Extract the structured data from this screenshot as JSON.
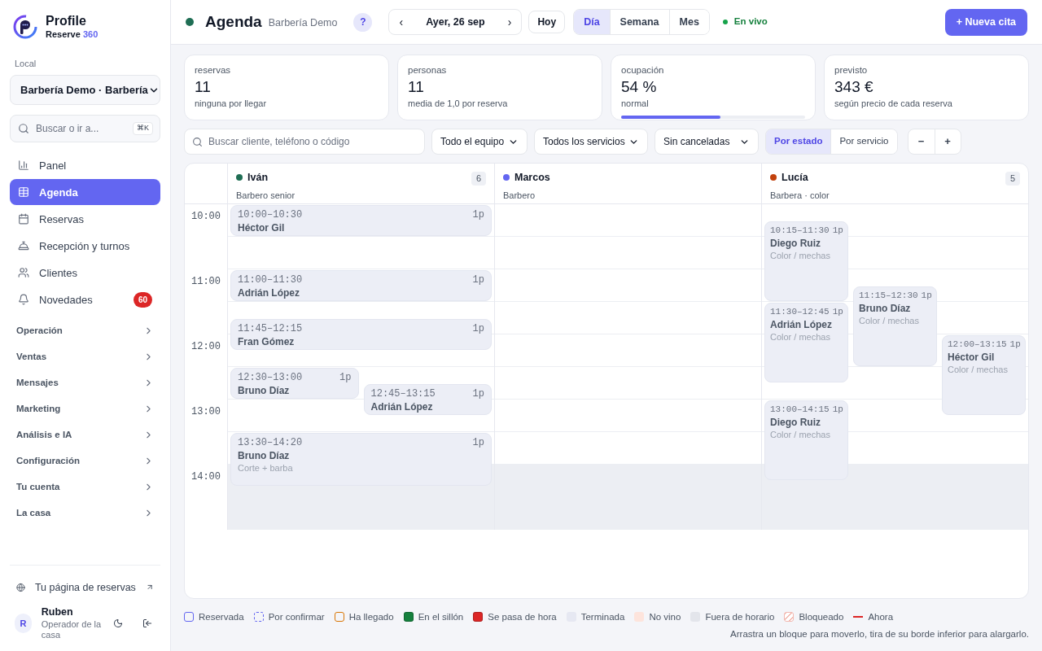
{
  "brand": {
    "name": "Profile",
    "sub": "Reserve",
    "sub_accent": "360"
  },
  "sidebar": {
    "local_label": "Local",
    "local_value": "Barbería Demo · Barbería",
    "search_placeholder": "Buscar o ir a...",
    "shortcut": "⌘K",
    "items": [
      {
        "kind": "panel",
        "label": "Panel",
        "selected": false
      },
      {
        "kind": "agenda",
        "label": "Agenda",
        "selected": true
      },
      {
        "kind": "reservas",
        "label": "Reservas",
        "selected": false
      },
      {
        "kind": "recepcion",
        "label": "Recepción y turnos",
        "selected": false
      },
      {
        "kind": "clientes",
        "label": "Clientes",
        "selected": false
      },
      {
        "kind": "novedades",
        "label": "Novedades",
        "selected": false,
        "badge": "60"
      }
    ],
    "sections": [
      {
        "label": "Operación",
        "expanded": false
      },
      {
        "label": "Ventas",
        "expanded": false
      },
      {
        "label": "Mensajes",
        "expanded": false
      },
      {
        "label": "Marketing",
        "expanded": false
      },
      {
        "label": "Análisis e IA",
        "expanded": false
      },
      {
        "label": "Configuración",
        "expanded": false
      },
      {
        "label": "Tu cuenta",
        "expanded": false
      },
      {
        "label": "La casa",
        "expanded": false
      }
    ],
    "public_link": "Tu página de reservas",
    "user": {
      "initial": "R",
      "name": "Ruben",
      "role": "Operador de la casa"
    }
  },
  "header": {
    "title": "Agenda",
    "subtitle": "Barbería Demo",
    "help": "?",
    "prev": "‹",
    "date": "Ayer, 26 sep",
    "next": "›",
    "today": "Hoy",
    "views": [
      {
        "label": "Día",
        "selected": true
      },
      {
        "label": "Semana",
        "selected": false
      },
      {
        "label": "Mes",
        "selected": false
      }
    ],
    "live": "En vivo",
    "new_button": "+ Nueva cita"
  },
  "stats": [
    {
      "label": "reservas",
      "value": "11",
      "note": "ninguna por llegar"
    },
    {
      "label": "personas",
      "value": "11",
      "note": "media de 1,0 por reserva"
    },
    {
      "label": "ocupación",
      "value": "54 %",
      "note": "normal",
      "level": 0.54
    },
    {
      "label": "previsto",
      "value": "343 €",
      "note": "según precio de cada reserva"
    }
  ],
  "filters": {
    "search_placeholder": "Buscar cliente, teléfono o código",
    "team": "Todo el equipo",
    "services": "Todos los servicios",
    "cancel": "Sin canceladas",
    "color_modes": [
      {
        "label": "Por estado",
        "selected": true
      },
      {
        "label": "Por servicio",
        "selected": false
      }
    ],
    "zoom_out": "−",
    "zoom_in": "+"
  },
  "calendar": {
    "hours": [
      {
        "label": "10:00",
        "open": true
      },
      {
        "label": "11:00",
        "open": true
      },
      {
        "label": "12:00",
        "open": true
      },
      {
        "label": "13:00",
        "open": true
      },
      {
        "label": "14:00",
        "open": false
      }
    ],
    "staff": [
      {
        "name": "Iván",
        "role": "Barbero senior",
        "color": "#1f6e54",
        "count": "6",
        "events": [
          {
            "kind": "finished",
            "time": "10:00–10:30",
            "people": "1p",
            "client": "Héctor Gil"
          },
          {
            "kind": "finished",
            "time": "11:00–11:30",
            "people": "1p",
            "client": "Adrián López"
          },
          {
            "kind": "finished",
            "time": "11:45–12:15",
            "people": "1p",
            "client": "Fran Gómez"
          },
          {
            "kind": "finished",
            "time": "12:30–13:00",
            "people": "1p",
            "client": "Bruno Díaz"
          },
          {
            "kind": "finished",
            "time": "12:45–13:15",
            "people": "1p",
            "client": "Adrián López"
          },
          {
            "kind": "finished",
            "time": "13:30–14:20",
            "people": "1p",
            "client": "Bruno Díaz",
            "service": "Corte + barba"
          }
        ]
      },
      {
        "name": "Marcos",
        "role": "Barbero",
        "color": "#6366f1"
      },
      {
        "name": "Lucía",
        "role": "Barbera · color",
        "color": "#c2410c",
        "count": "5",
        "events": [
          {
            "kind": "finished",
            "time": "10:15–11:30",
            "people": "1p",
            "client": "Diego Ruiz",
            "service": "Color / mechas"
          },
          {
            "kind": "finished",
            "time": "11:15–12:30",
            "people": "1p",
            "client": "Bruno Díaz",
            "service": "Color / mechas"
          },
          {
            "kind": "finished",
            "time": "11:30–12:45",
            "people": "1p",
            "client": "Adrián López",
            "service": "Color / mechas"
          },
          {
            "kind": "finished",
            "time": "12:00–13:15",
            "people": "1p",
            "client": "Héctor Gil",
            "service": "Color / mechas"
          },
          {
            "kind": "finished",
            "time": "13:00–14:15",
            "people": "1p",
            "client": "Diego Ruiz",
            "service": "Color / mechas"
          }
        ]
      }
    ]
  },
  "legend": [
    {
      "kind": "outline",
      "color": "#6366f1",
      "label": "Reservada"
    },
    {
      "kind": "dashed",
      "color": "#6366f1",
      "label": "Por confirmar"
    },
    {
      "kind": "outline",
      "color": "#d97706",
      "label": "Ha llegado"
    },
    {
      "kind": "filled",
      "color": "#15803d",
      "label": "En el sillón"
    },
    {
      "kind": "filled",
      "color": "#dc2626",
      "label": "Se pasa de hora"
    },
    {
      "kind": "soft",
      "color": "#e6e8f2",
      "label": "Terminada"
    },
    {
      "kind": "soft",
      "color": "#fde4dc",
      "label": "No vino"
    },
    {
      "kind": "soft",
      "color": "#e3e5eb",
      "label": "Fuera de horario"
    },
    {
      "kind": "striped",
      "color": "#f2b8b0",
      "label": "Bloqueado"
    },
    {
      "kind": "line",
      "color": "#dc2626",
      "label": "Ahora"
    }
  ],
  "hint": "Arrastra un bloque para moverlo, tira de su borde inferior para alargarlo."
}
